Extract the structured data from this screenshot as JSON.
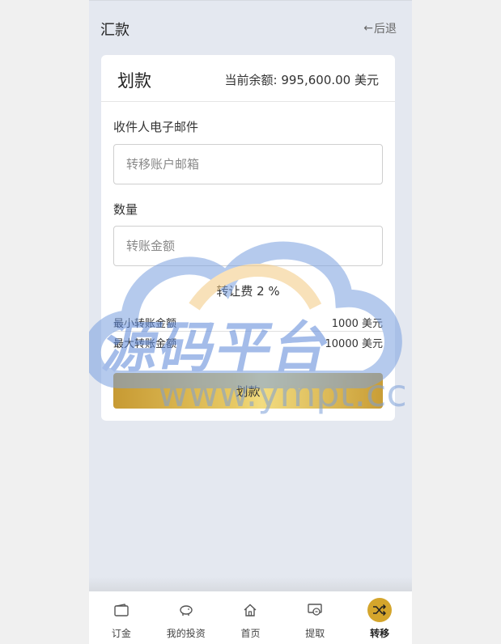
{
  "header": {
    "title": "汇款",
    "back_label": "后退"
  },
  "card": {
    "title": "划款",
    "balance_label": "当前余额: ",
    "balance_value": "995,600.00 美元",
    "recipient_label": "收件人电子邮件",
    "recipient_placeholder": "转移账户邮箱",
    "amount_label": "数量",
    "amount_placeholder": "转账金额",
    "fee_text": "转让费 2 %",
    "min_label": "最小转账金额",
    "min_value": "1000 美元",
    "max_label": "最大转账金额",
    "max_value": "10000 美元",
    "submit_label": "划款"
  },
  "watermark": {
    "text": "源码平台",
    "url": "www.ympt.cc"
  },
  "tabs": [
    {
      "label": "订金",
      "icon": "wallet-icon"
    },
    {
      "label": "我的投资",
      "icon": "piggy-bank-icon"
    },
    {
      "label": "首页",
      "icon": "home-icon"
    },
    {
      "label": "提取",
      "icon": "withdraw-icon"
    },
    {
      "label": "转移",
      "icon": "transfer-icon",
      "active": true
    }
  ],
  "colors": {
    "accent": "#d4a52c",
    "background": "#e4e8f0"
  }
}
